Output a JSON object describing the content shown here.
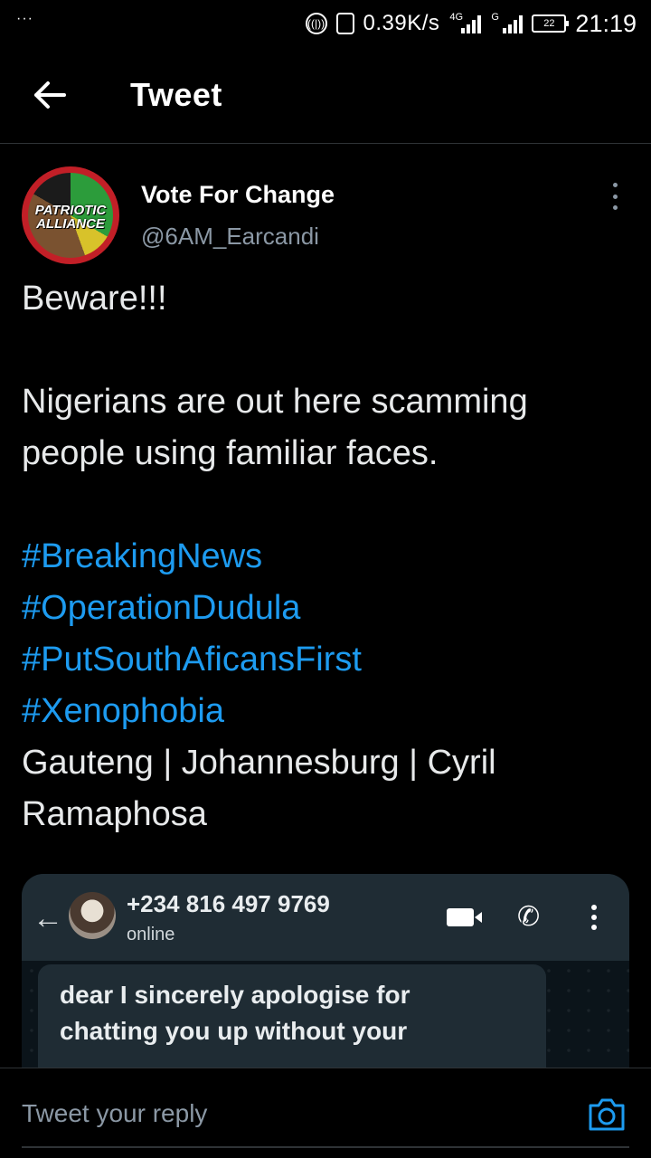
{
  "status_bar": {
    "left_dots": "···",
    "net_speed": "0.39K/s",
    "sim1_label": "4G",
    "sim2_label": "G",
    "battery": "22",
    "time": "21:19"
  },
  "header": {
    "title": "Tweet"
  },
  "tweet": {
    "avatar_text_line1": "PATRIOTIC",
    "avatar_text_line2": "ALLIANCE",
    "display_name": "Vote For Change",
    "handle": "@6AM_Earcandi",
    "line1": "Beware!!!",
    "line2a": "Nigerians are out here scamming",
    "line2b": "people using familiar faces.",
    "hashtags": [
      "#BreakingNews",
      "#OperationDudula",
      "#PutSouthAficansFirst",
      "#Xenophobia"
    ],
    "line3a": "Gauteng | Johannesburg | Cyril",
    "line3b": "Ramaphosa"
  },
  "media": {
    "phone_number": "+234 816 497 9769",
    "presence": "online",
    "message_line1": "dear I sincerely apologise for",
    "message_line2": "chatting you up without your"
  },
  "reply": {
    "placeholder": "Tweet your reply"
  },
  "colors": {
    "accent": "#1d9bf0",
    "secondary_text": "#8b98a5",
    "background": "#000000"
  },
  "icons": [
    "back-arrow-icon",
    "more-vertical-icon",
    "camera-icon",
    "video-call-icon",
    "phone-icon"
  ]
}
